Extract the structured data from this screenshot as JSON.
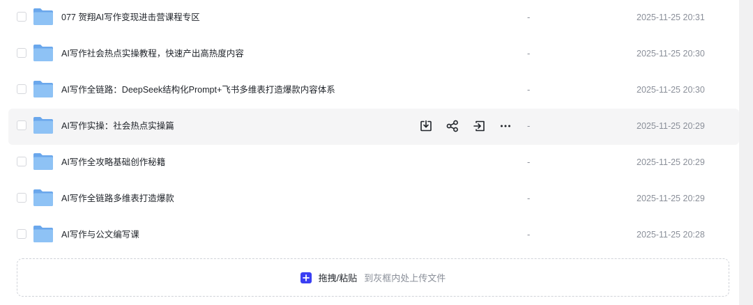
{
  "files": [
    {
      "name": "077 贺翔AI写作变现进击营课程专区",
      "size": "-",
      "modified": "2025-11-25 20:31"
    },
    {
      "name": "AI写作社会热点实操教程，快速产出高热度内容",
      "size": "-",
      "modified": "2025-11-25 20:30"
    },
    {
      "name": "AI写作全链路：DeepSeek结构化Prompt+飞书多维表打造爆款内容体系",
      "size": "-",
      "modified": "2025-11-25 20:30"
    },
    {
      "name": "AI写作实操：社会热点实操篇",
      "size": "-",
      "modified": "2025-11-25 20:29"
    },
    {
      "name": "AI写作全攻略基础创作秘籍",
      "size": "-",
      "modified": "2025-11-25 20:29"
    },
    {
      "name": "AI写作全链路多维表打造爆款",
      "size": "-",
      "modified": "2025-11-25 20:29"
    },
    {
      "name": "AI写作与公文编写课",
      "size": "-",
      "modified": "2025-11-25 20:28"
    }
  ],
  "hovered_row_actions": [
    "download-icon",
    "share-icon",
    "move-icon",
    "more-icon"
  ],
  "upload": {
    "label": "拖拽/粘贴",
    "hint": "到灰框内处上传文件"
  },
  "colors": {
    "accent": "#3a3ff3",
    "folder": "#7fb5f0",
    "hover_bg": "#f5f5f6"
  }
}
